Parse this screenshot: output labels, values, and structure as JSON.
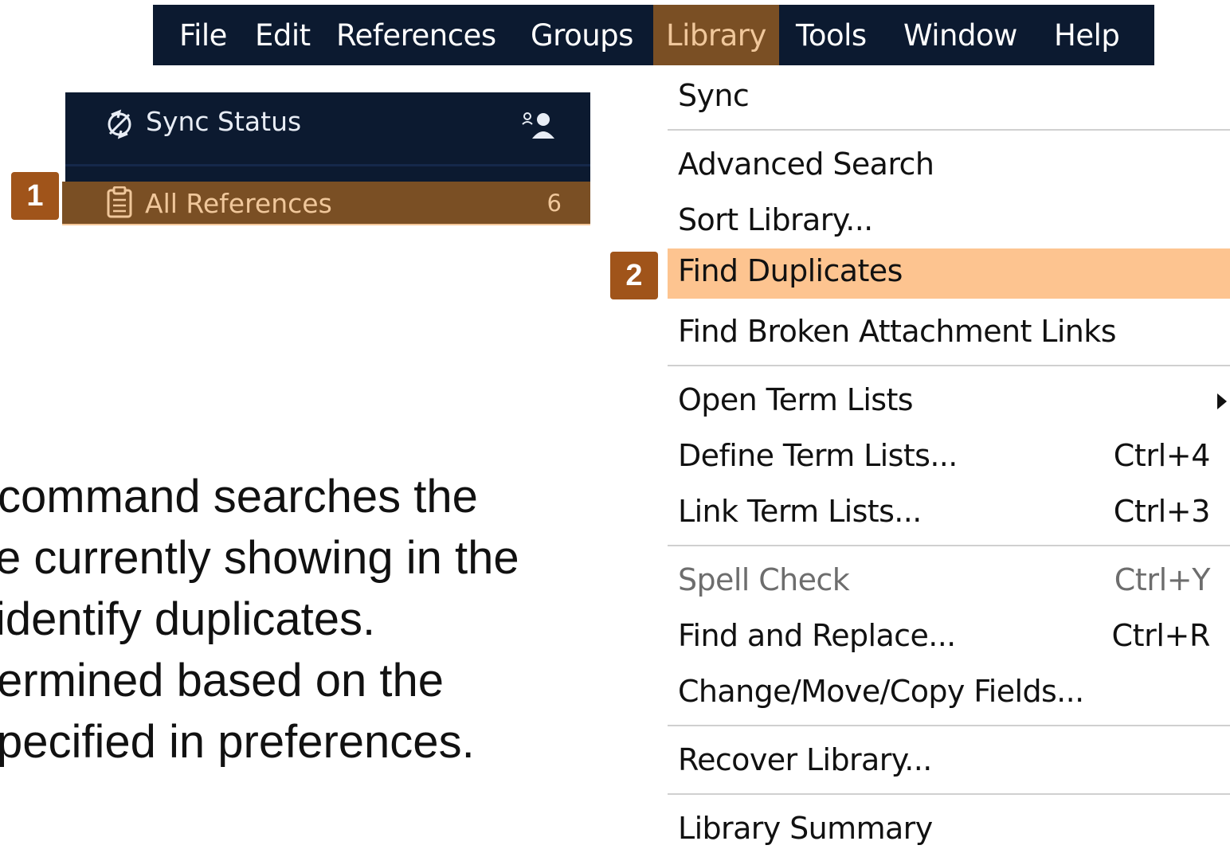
{
  "menubar": {
    "items": [
      {
        "label": "File"
      },
      {
        "label": "Edit"
      },
      {
        "label": "References"
      },
      {
        "label": "Groups"
      },
      {
        "label": "Library",
        "active": true
      },
      {
        "label": "Tools"
      },
      {
        "label": "Window"
      },
      {
        "label": "Help"
      }
    ]
  },
  "sidebar": {
    "sync_label": "Sync Status",
    "sync_icon": "sync-icon",
    "share_icon": "share-users-icon",
    "all_references_label": "All References",
    "all_references_count": "6",
    "all_references_icon": "clipboard-icon"
  },
  "badges": {
    "step1": "1",
    "step2": "2"
  },
  "library_menu": {
    "items": [
      {
        "label": "Sync",
        "shortcut": ""
      },
      {
        "label": "Advanced Search",
        "shortcut": ""
      },
      {
        "label": "Sort Library...",
        "shortcut": ""
      },
      {
        "label": "Find Duplicates",
        "shortcut": "",
        "highlighted": true
      },
      {
        "label": "Find Broken Attachment Links",
        "shortcut": ""
      },
      {
        "label": "Open Term Lists",
        "shortcut": "",
        "submenu": true
      },
      {
        "label": "Define Term Lists...",
        "shortcut": "Ctrl+4"
      },
      {
        "label": "Link Term Lists...",
        "shortcut": "Ctrl+3"
      },
      {
        "label": "Spell Check",
        "shortcut": "Ctrl+Y",
        "disabled": true
      },
      {
        "label": "Find and Replace...",
        "shortcut": "Ctrl+R"
      },
      {
        "label": "Change/Move/Copy Fields...",
        "shortcut": ""
      },
      {
        "label": "Recover Library...",
        "shortcut": ""
      },
      {
        "label": "Library Summary",
        "shortcut": ""
      }
    ]
  },
  "explanation": {
    "lines": [
      "command searches the",
      "e currently showing in the",
      " identify duplicates.",
      "ermined based on the",
      "pecified in preferences."
    ]
  },
  "colors": {
    "menubar_bg": "#0c1a30",
    "active_bg": "#7a4f24",
    "active_text": "#f0c79b",
    "highlight_bg": "#fdc490",
    "badge_bg": "#a0541a"
  }
}
